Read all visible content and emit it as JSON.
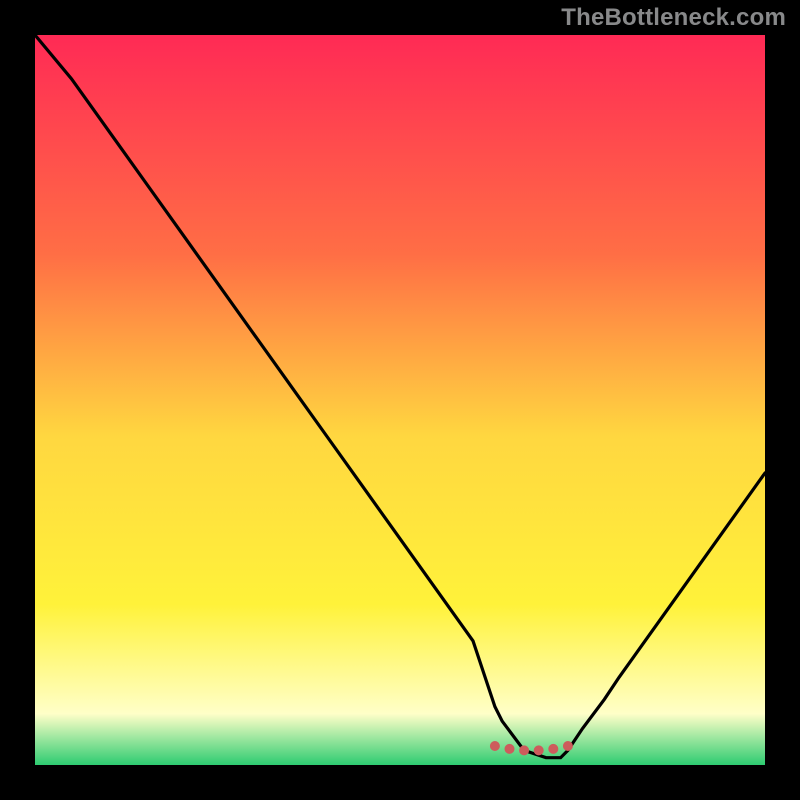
{
  "watermark": "TheBottleneck.com",
  "colors": {
    "background": "#000000",
    "curve": "#000000",
    "dot": "#cd5c5c",
    "gradient_top": "#ff2a55",
    "gradient_mid_upper": "#ff6e45",
    "gradient_mid": "#ffd740",
    "gradient_mid_lower": "#fff23a",
    "gradient_near_bottom": "#ffffc8",
    "gradient_bottom": "#2ecc71"
  },
  "chart_data": {
    "type": "line",
    "title": "",
    "xlabel": "",
    "ylabel": "",
    "xlim": [
      0,
      100
    ],
    "ylim": [
      0,
      100
    ],
    "grid": false,
    "series": [
      {
        "name": "bottleneck-curve",
        "x": [
          0,
          5,
          10,
          15,
          20,
          25,
          30,
          35,
          40,
          45,
          50,
          55,
          60,
          62,
          63,
          64,
          67,
          70,
          72,
          73,
          75,
          78,
          80,
          85,
          90,
          95,
          100
        ],
        "values": [
          100,
          94,
          87,
          80,
          73,
          66,
          59,
          52,
          45,
          38,
          31,
          24,
          17,
          11,
          8,
          6,
          2,
          1,
          1,
          2,
          5,
          9,
          12,
          19,
          26,
          33,
          40
        ]
      }
    ],
    "markers": {
      "name": "optimal-range-dots",
      "x": [
        63,
        65,
        67,
        69,
        71,
        73
      ],
      "values": [
        2.6,
        2.2,
        2.0,
        2.0,
        2.2,
        2.6
      ]
    },
    "note": "x/y are percentages of the plotting area. The curve is the characteristic V-shaped bottleneck profile; the dotted coral span near the trough marks the region of minimal bottleneck."
  }
}
